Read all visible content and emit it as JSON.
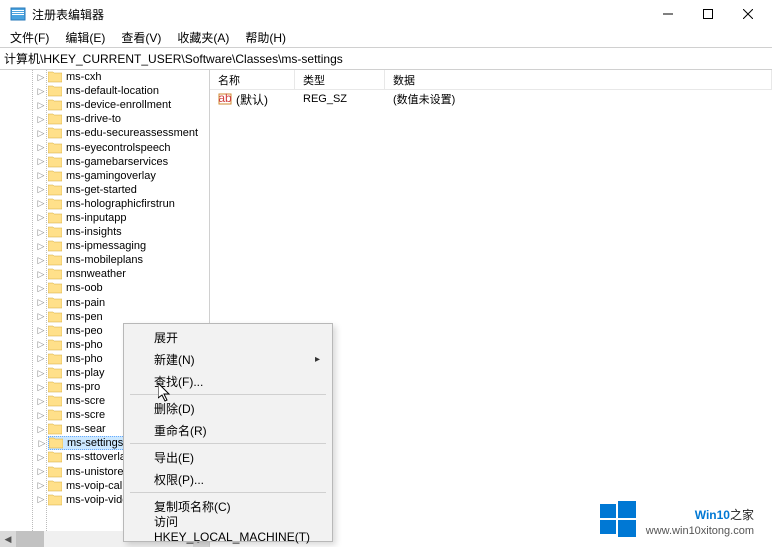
{
  "window": {
    "title": "注册表编辑器",
    "minimize_tip": "Minimize",
    "maximize_tip": "Maximize",
    "close_tip": "Close"
  },
  "menu": {
    "file": "文件(F)",
    "edit": "编辑(E)",
    "view": "查看(V)",
    "favorites": "收藏夹(A)",
    "help": "帮助(H)"
  },
  "address": {
    "path": "计算机\\HKEY_CURRENT_USER\\Software\\Classes\\ms-settings"
  },
  "tree": {
    "items": [
      {
        "label": "ms-cxh"
      },
      {
        "label": "ms-default-location"
      },
      {
        "label": "ms-device-enrollment"
      },
      {
        "label": "ms-drive-to"
      },
      {
        "label": "ms-edu-secureassessment"
      },
      {
        "label": "ms-eyecontrolspeech"
      },
      {
        "label": "ms-gamebarservices"
      },
      {
        "label": "ms-gamingoverlay"
      },
      {
        "label": "ms-get-started"
      },
      {
        "label": "ms-holographicfirstrun"
      },
      {
        "label": "ms-inputapp"
      },
      {
        "label": "ms-insights"
      },
      {
        "label": "ms-ipmessaging"
      },
      {
        "label": "ms-mobileplans"
      },
      {
        "label": "msnweather"
      },
      {
        "label": "ms-oob"
      },
      {
        "label": "ms-pain"
      },
      {
        "label": "ms-pen"
      },
      {
        "label": "ms-peo"
      },
      {
        "label": "ms-pho"
      },
      {
        "label": "ms-pho"
      },
      {
        "label": "ms-play"
      },
      {
        "label": "ms-pro"
      },
      {
        "label": "ms-scre"
      },
      {
        "label": "ms-scre"
      },
      {
        "label": "ms-sear"
      },
      {
        "label": "ms-settings",
        "selected": true
      },
      {
        "label": "ms-sttoverlay"
      },
      {
        "label": "ms-unistore-email"
      },
      {
        "label": "ms-voip-call"
      },
      {
        "label": "ms-voip-video"
      }
    ]
  },
  "list": {
    "headers": {
      "name": "名称",
      "type": "类型",
      "data": "数据"
    },
    "rows": [
      {
        "name": "(默认)",
        "type": "REG_SZ",
        "data": "(数值未设置)"
      }
    ]
  },
  "context_menu": {
    "expand": "展开",
    "new": "新建(N)",
    "find": "查找(F)...",
    "delete": "删除(D)",
    "rename": "重命名(R)",
    "export": "导出(E)",
    "permissions": "权限(P)...",
    "copy_key_name": "复制项名称(C)",
    "goto_hklm": "访问 HKEY_LOCAL_MACHINE(T)"
  },
  "watermark": {
    "brand_a": "Win10",
    "brand_b": "之家",
    "url": "www.win10xitong.com"
  }
}
